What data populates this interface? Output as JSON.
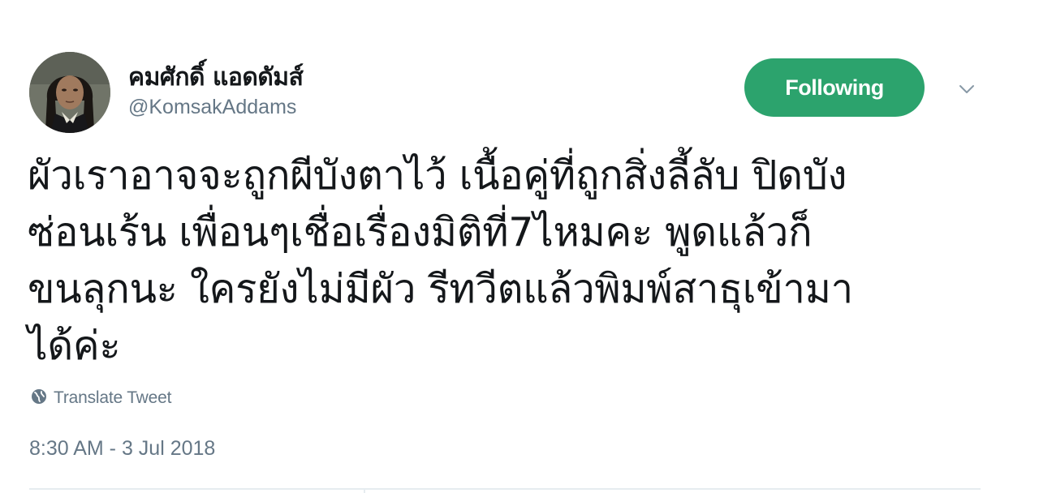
{
  "user": {
    "display_name": "คมศักดิ์ แอดดัมส์",
    "handle": "@KomsakAddams"
  },
  "follow_button": {
    "label": "Following",
    "color": "#2ca36d"
  },
  "tweet": {
    "text_lines": [
      "ผัวเราอาจจะถูกผีบังตาไว้ เนื้อคู่ที่ถูกสิ่งลี้ลับ ปิดบัง",
      "ซ่อนเร้น เพื่อนๆเชื่อเรื่องมิติที่7ไหมคะ พูดแล้วก็",
      "ขนลุกนะ ใครยังไม่มีผัว รีทวีตแล้วพิมพ์สาธุเข้ามา",
      "ได้ค่ะ"
    ],
    "translate_label": "Translate Tweet",
    "timestamp": "8:30 AM - 3 Jul 2018"
  },
  "icons": {
    "caret": "chevron-down-icon",
    "translate": "globe-icon"
  }
}
